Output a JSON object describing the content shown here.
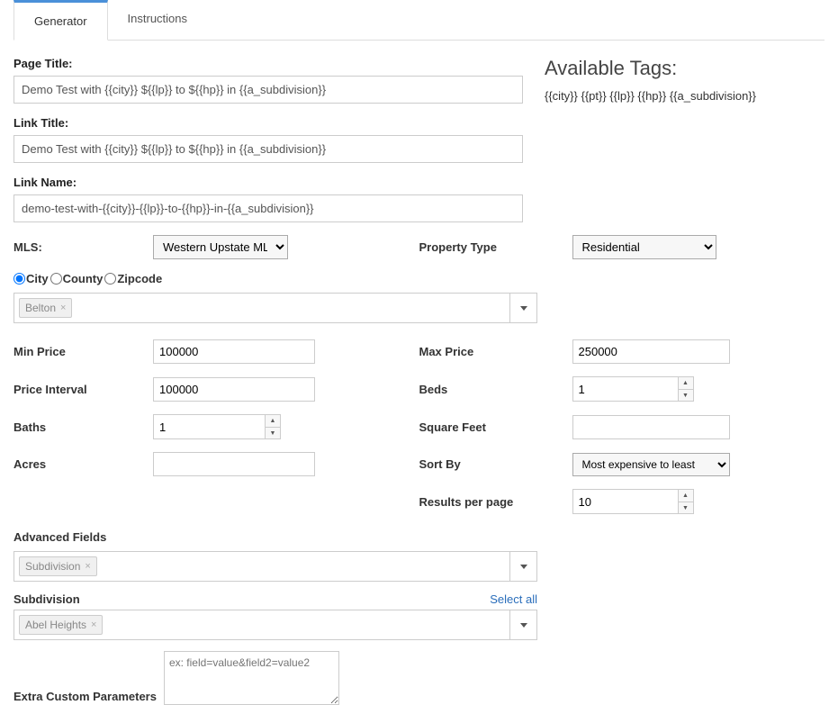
{
  "tabs": {
    "generator": "Generator",
    "instructions": "Instructions"
  },
  "availableTags": {
    "title": "Available Tags:",
    "list": "{{city}} {{pt}} {{lp}} {{hp}} {{a_subdivision}}"
  },
  "labels": {
    "pageTitle": "Page Title:",
    "linkTitle": "Link Title:",
    "linkName": "Link Name:",
    "mls": "MLS:",
    "propertyType": "Property Type",
    "minPrice": "Min Price",
    "maxPrice": "Max Price",
    "priceInterval": "Price Interval",
    "beds": "Beds",
    "baths": "Baths",
    "squareFeet": "Square Feet",
    "acres": "Acres",
    "sortBy": "Sort By",
    "resultsPerPage": "Results per page",
    "advancedFields": "Advanced Fields",
    "subdivision": "Subdivision",
    "selectAll": "Select all",
    "extraCustom": "Extra Custom Parameters"
  },
  "radios": {
    "city": "City",
    "county": "County",
    "zipcode": "Zipcode"
  },
  "values": {
    "pageTitle": "Demo Test with {{city}} ${{lp}} to ${{hp}} in {{a_subdivision}}",
    "linkTitle": "Demo Test with {{city}} ${{lp}} to ${{hp}} in {{a_subdivision}}",
    "linkName": "demo-test-with-{{city}}-{{lp}}-to-{{hp}}-in-{{a_subdivision}}",
    "mlsSelected": "Western Upstate MLS",
    "propertyTypeSelected": "Residential",
    "cityChip": "Belton",
    "minPrice": "100000",
    "maxPrice": "250000",
    "priceInterval": "100000",
    "beds": "1",
    "baths": "1",
    "squareFeet": "",
    "acres": "",
    "sortBy": "Most expensive to least",
    "resultsPerPage": "10",
    "advChip": "Subdivision",
    "subdivChip": "Abel Heights",
    "extraPlaceholder": "ex: field=value&field2=value2"
  }
}
